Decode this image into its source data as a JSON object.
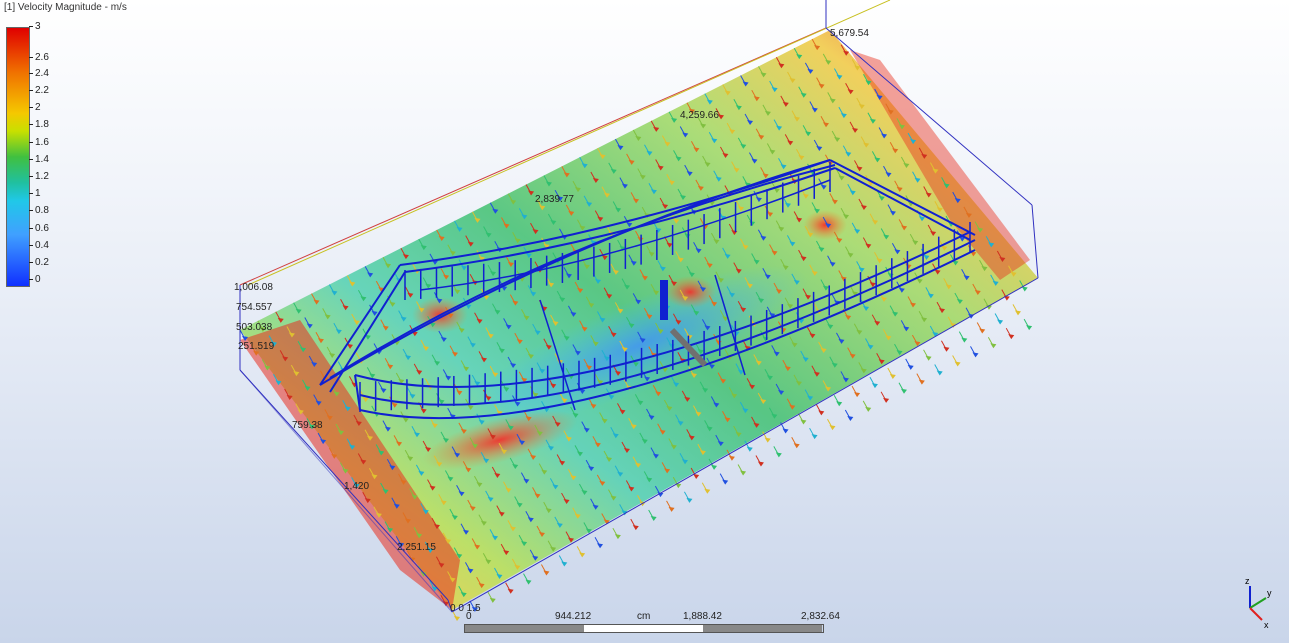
{
  "legend": {
    "title": "[1] Velocity Magnitude - m/s",
    "ticks": [
      "3",
      "2.6",
      "2.4",
      "2.2",
      "2",
      "1.8",
      "1.6",
      "1.4",
      "1.2",
      "1",
      "0.8",
      "0.6",
      "0.4",
      "0.2",
      "0"
    ]
  },
  "model_labels": {
    "corner_top": "5,679.54",
    "mid_upper": "4,259.66",
    "mid_center": "2,839.77",
    "vert_1": "1,006.08",
    "vert_2": "754.557",
    "vert_3": "503.038",
    "vert_4": "251.519",
    "side_1": "759.38",
    "side_2": "1,420",
    "side_3": "2,251.15",
    "origin": "0 0 1.5"
  },
  "scale": {
    "zero": "0",
    "v1": "944.212",
    "unit": "cm",
    "v2": "1,888.42",
    "v3": "2,832.64"
  },
  "triad": {
    "z": "z",
    "y": "y",
    "x": "x"
  },
  "colors": {
    "red": "#e02020",
    "orange": "#f08020",
    "yellow": "#f0e040",
    "green": "#40c040",
    "cyan": "#30c8e0",
    "blue": "#1020e0"
  }
}
